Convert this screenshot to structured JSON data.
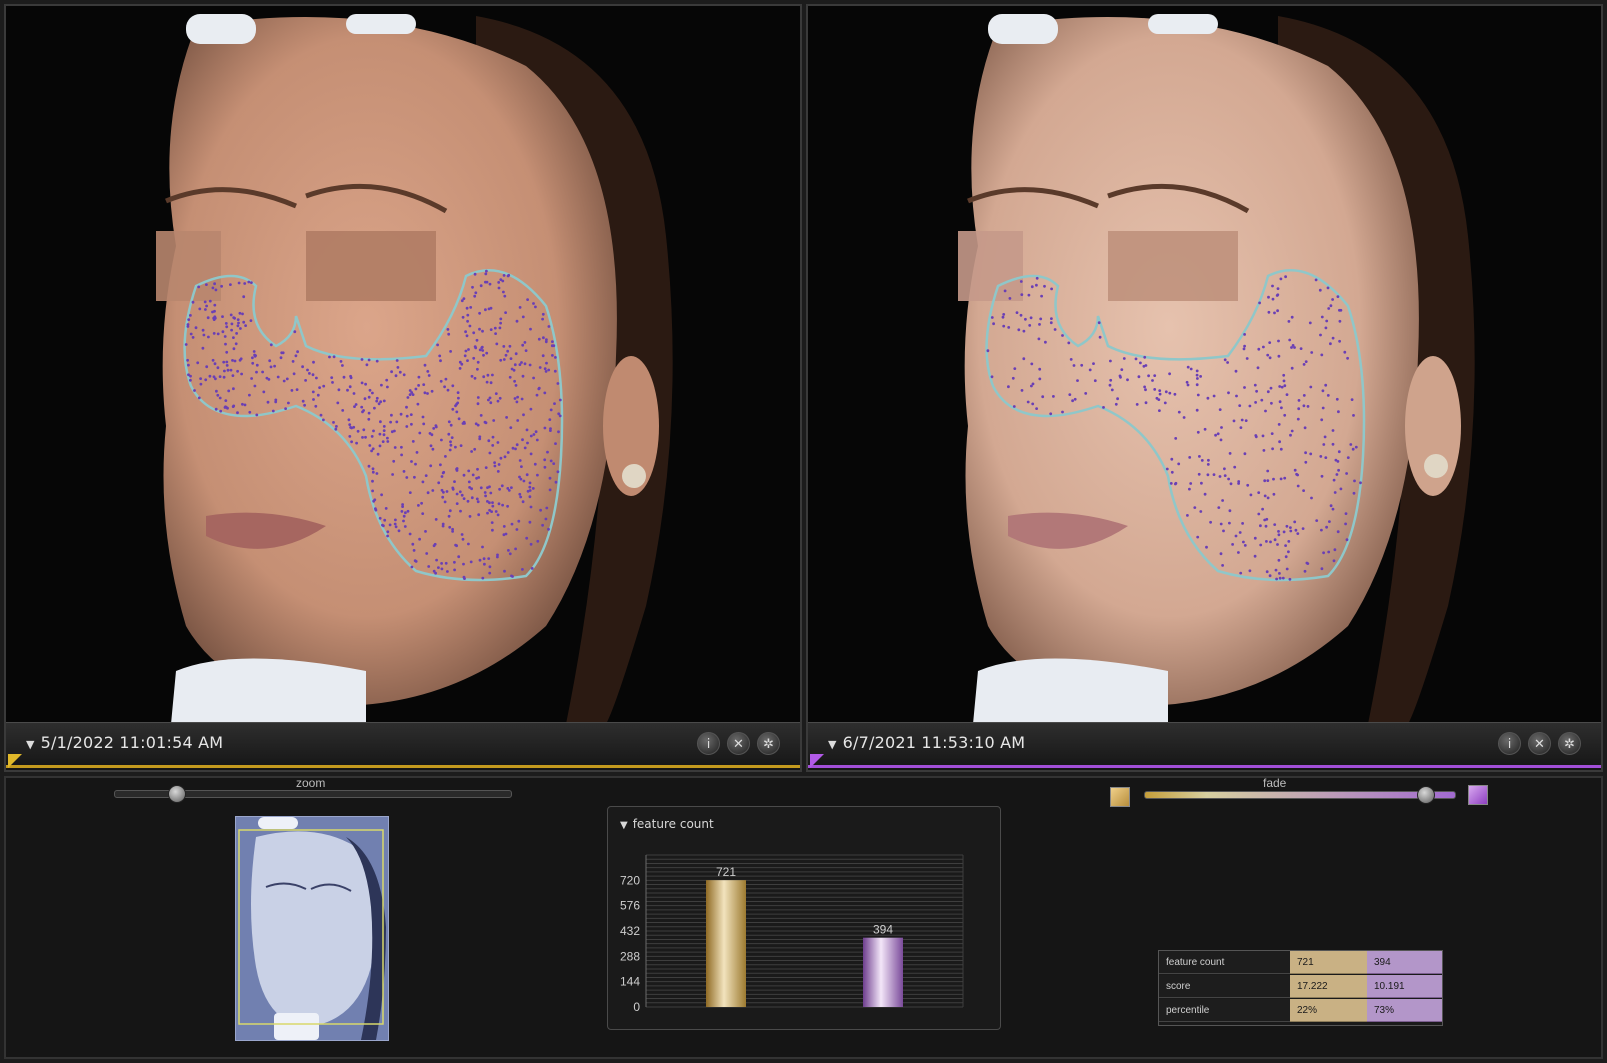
{
  "left_panel": {
    "date": "5/1/2022 11:01:54 AM",
    "accent": "#c49a1e"
  },
  "right_panel": {
    "date": "6/7/2021 11:53:10 AM",
    "accent": "#a24fd8"
  },
  "caption_icons": [
    "info-icon",
    "close-icon",
    "settings-icon"
  ],
  "zoom": {
    "label": "zoom",
    "value": 0.14
  },
  "fade": {
    "label": "fade",
    "value": 0.92
  },
  "chart_data": {
    "type": "bar",
    "title": "feature count",
    "categories": [
      "",
      ""
    ],
    "values": [
      721,
      394
    ],
    "data_labels": [
      "721",
      "394"
    ],
    "yticks": [
      0,
      144,
      288,
      432,
      576,
      720
    ],
    "ylim": [
      0,
      864
    ],
    "colors": [
      "#c9a24a",
      "#b07ad0"
    ],
    "grid": true
  },
  "stats": {
    "rows": [
      {
        "name": "feature count",
        "a": "721",
        "b": "394"
      },
      {
        "name": "score",
        "a": "17.222",
        "b": "10.191"
      },
      {
        "name": "percentile",
        "a": "22%",
        "b": "73%"
      }
    ]
  }
}
